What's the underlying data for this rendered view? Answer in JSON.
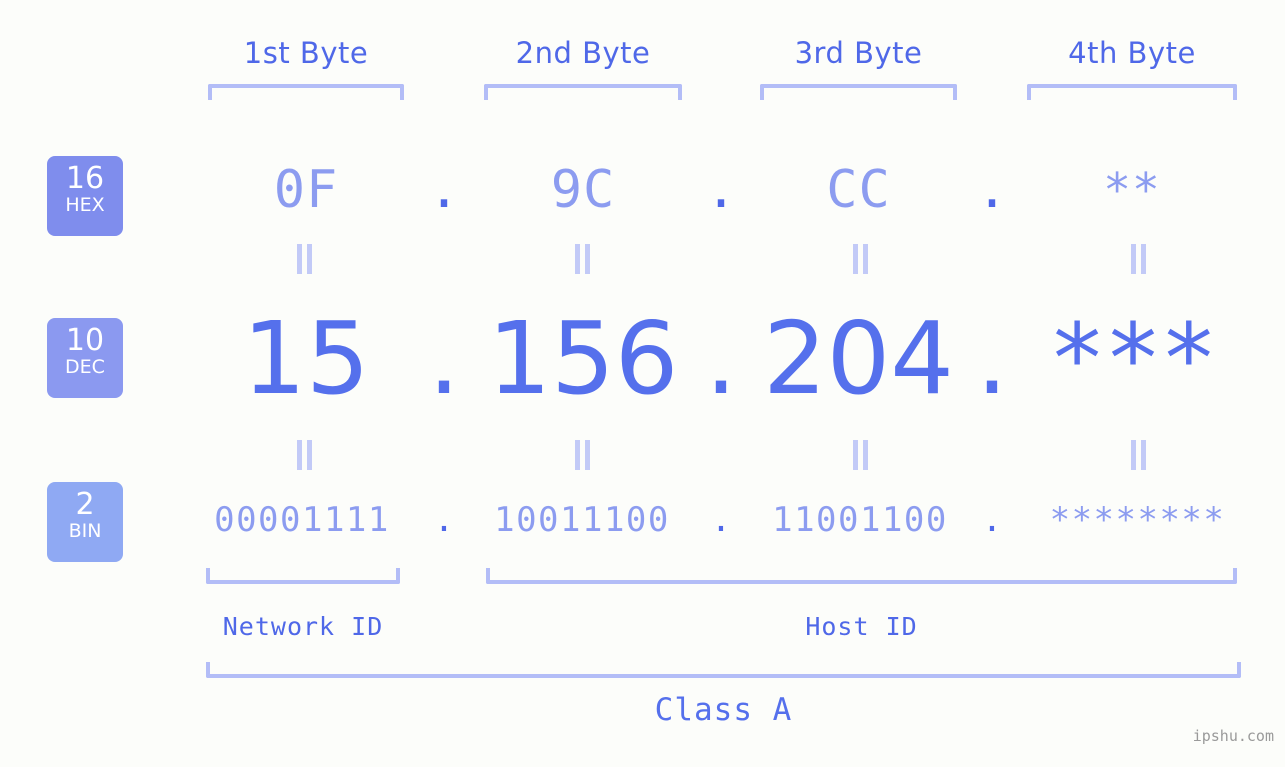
{
  "meta": {
    "background_color": "#fcfdfa",
    "accent_strong": "#5570ec",
    "accent_mid": "#8c9cf0",
    "accent_light": "#b3bdf7"
  },
  "byte_headers": [
    {
      "label": "1st Byte"
    },
    {
      "label": "2nd Byte"
    },
    {
      "label": "3rd Byte"
    },
    {
      "label": "4th Byte"
    }
  ],
  "bases": [
    {
      "number": "16",
      "name": "HEX",
      "color": "#7f8ded"
    },
    {
      "number": "10",
      "name": "DEC",
      "color": "#8b99f0"
    },
    {
      "number": "2",
      "name": "BIN",
      "color": "#8fa9f3"
    }
  ],
  "separator": ".",
  "rows": {
    "hex": {
      "base_number": "16",
      "base_name": "HEX",
      "values": [
        "0F",
        "9C",
        "CC",
        "**"
      ]
    },
    "dec": {
      "base_number": "10",
      "base_name": "DEC",
      "values": [
        "15",
        "156",
        "204",
        "***"
      ]
    },
    "bin": {
      "base_number": "2",
      "base_name": "BIN",
      "values": [
        "00001111",
        "10011100",
        "11001100",
        "********"
      ]
    }
  },
  "equals_symbol": "||",
  "segments": [
    {
      "label": "Network ID"
    },
    {
      "label": "Host ID"
    }
  ],
  "class": {
    "label": "Class A"
  },
  "watermark": {
    "text": "ipshu.com"
  },
  "icons": {
    "bracket_down": "bracket-down-icon",
    "bracket_up": "bracket-up-icon",
    "equals": "equals-connector-icon"
  }
}
